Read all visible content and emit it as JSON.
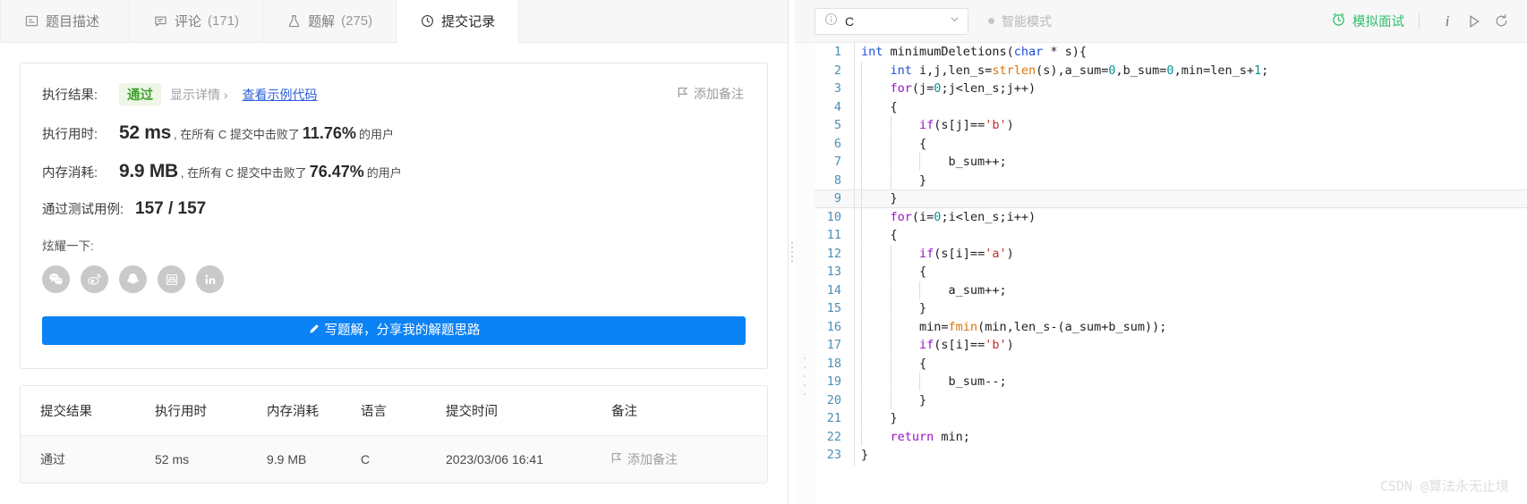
{
  "tabs": [
    {
      "label": "题目描述",
      "count": "",
      "icon": "description-icon",
      "active": false
    },
    {
      "label": "评论",
      "count": "(171)",
      "icon": "comment-icon",
      "active": false
    },
    {
      "label": "题解",
      "count": "(275)",
      "icon": "flask-icon",
      "active": false
    },
    {
      "label": "提交记录",
      "count": "",
      "icon": "clock-icon",
      "active": true
    }
  ],
  "result": {
    "exec_result_label": "执行结果:",
    "status": "通过",
    "show_detail": "显示详情 ›",
    "view_sample_code": "查看示例代码",
    "add_note": "添加备注",
    "runtime_label": "执行用时:",
    "runtime_value": "52 ms",
    "runtime_prefix": ", 在所有 C 提交中击败了",
    "runtime_pct": "11.76%",
    "runtime_suffix": "的用户",
    "memory_label": "内存消耗:",
    "memory_value": "9.9 MB",
    "memory_prefix": ", 在所有 C 提交中击败了",
    "memory_pct": "76.47%",
    "memory_suffix": "的用户",
    "cases_label": "通过测试用例:",
    "cases_value": "157 / 157",
    "share_label": "炫耀一下:",
    "share_buttons": [
      "wechat-icon",
      "weibo-icon",
      "qq-icon",
      "douban-icon",
      "linkedin-icon"
    ],
    "write_solution_button": "写题解，分享我的解题思路"
  },
  "submissions_table": {
    "headers": [
      "提交结果",
      "执行用时",
      "内存消耗",
      "语言",
      "提交时间",
      "备注"
    ],
    "rows": [
      {
        "status": "通过",
        "runtime": "52 ms",
        "memory": "9.9 MB",
        "language": "C",
        "time": "2023/03/06 16:41",
        "note": "添加备注"
      }
    ]
  },
  "editor_header": {
    "language": "C",
    "language_info_icon": "info-icon",
    "chevron_icon": "chevron-down-icon",
    "smart_mode": "智能模式",
    "mock_interview": "模拟面试",
    "info_button": "i",
    "run_icon": "play-icon",
    "reset_icon": "refresh-icon"
  },
  "code": {
    "language": "C",
    "lines": [
      {
        "n": "1",
        "indent": 0,
        "current": false,
        "tokens": [
          {
            "t": "int",
            "c": "typ"
          },
          {
            "t": " ",
            "c": "op"
          },
          {
            "t": "minimumDeletions",
            "c": "fname"
          },
          {
            "t": "(",
            "c": "op"
          },
          {
            "t": "char",
            "c": "typ"
          },
          {
            "t": " * s){",
            "c": "op"
          }
        ]
      },
      {
        "n": "2",
        "indent": 1,
        "current": false,
        "tokens": [
          {
            "t": "int",
            "c": "typ"
          },
          {
            "t": " i,j,len_s=",
            "c": "op"
          },
          {
            "t": "strlen",
            "c": "fn"
          },
          {
            "t": "(s),a_sum=",
            "c": "op"
          },
          {
            "t": "0",
            "c": "num"
          },
          {
            "t": ",b_sum=",
            "c": "op"
          },
          {
            "t": "0",
            "c": "num"
          },
          {
            "t": ",min=len_s+",
            "c": "op"
          },
          {
            "t": "1",
            "c": "num"
          },
          {
            "t": ";",
            "c": "op"
          }
        ]
      },
      {
        "n": "3",
        "indent": 1,
        "current": false,
        "tokens": [
          {
            "t": "for",
            "c": "kw"
          },
          {
            "t": "(j=",
            "c": "op"
          },
          {
            "t": "0",
            "c": "num"
          },
          {
            "t": ";j<len_s;j++)",
            "c": "op"
          }
        ]
      },
      {
        "n": "4",
        "indent": 1,
        "current": false,
        "tokens": [
          {
            "t": "{",
            "c": "op"
          }
        ]
      },
      {
        "n": "5",
        "indent": 2,
        "current": false,
        "tokens": [
          {
            "t": "if",
            "c": "kw"
          },
          {
            "t": "(s[j]==",
            "c": "op"
          },
          {
            "t": "'b'",
            "c": "str"
          },
          {
            "t": ")",
            "c": "op"
          }
        ]
      },
      {
        "n": "6",
        "indent": 2,
        "current": false,
        "tokens": [
          {
            "t": "{",
            "c": "op"
          }
        ]
      },
      {
        "n": "7",
        "indent": 3,
        "current": false,
        "tokens": [
          {
            "t": "b_sum++;",
            "c": "op"
          }
        ]
      },
      {
        "n": "8",
        "indent": 2,
        "current": false,
        "tokens": [
          {
            "t": "}",
            "c": "op"
          }
        ]
      },
      {
        "n": "9",
        "indent": 1,
        "current": true,
        "tokens": [
          {
            "t": "}",
            "c": "op"
          }
        ]
      },
      {
        "n": "10",
        "indent": 1,
        "current": false,
        "tokens": [
          {
            "t": "for",
            "c": "kw"
          },
          {
            "t": "(i=",
            "c": "op"
          },
          {
            "t": "0",
            "c": "num"
          },
          {
            "t": ";i<len_s;i++)",
            "c": "op"
          }
        ]
      },
      {
        "n": "11",
        "indent": 1,
        "current": false,
        "tokens": [
          {
            "t": "{",
            "c": "op"
          }
        ]
      },
      {
        "n": "12",
        "indent": 2,
        "current": false,
        "tokens": [
          {
            "t": "if",
            "c": "kw"
          },
          {
            "t": "(s[i]==",
            "c": "op"
          },
          {
            "t": "'a'",
            "c": "str"
          },
          {
            "t": ")",
            "c": "op"
          }
        ]
      },
      {
        "n": "13",
        "indent": 2,
        "current": false,
        "tokens": [
          {
            "t": "{",
            "c": "op"
          }
        ]
      },
      {
        "n": "14",
        "indent": 3,
        "current": false,
        "tokens": [
          {
            "t": "a_sum++;",
            "c": "op"
          }
        ]
      },
      {
        "n": "15",
        "indent": 2,
        "current": false,
        "tokens": [
          {
            "t": "}",
            "c": "op"
          }
        ]
      },
      {
        "n": "16",
        "indent": 2,
        "current": false,
        "tokens": [
          {
            "t": "min=",
            "c": "op"
          },
          {
            "t": "fmin",
            "c": "fn"
          },
          {
            "t": "(min,len_s-(a_sum+b_sum));",
            "c": "op"
          }
        ]
      },
      {
        "n": "17",
        "indent": 2,
        "current": false,
        "tokens": [
          {
            "t": "if",
            "c": "kw"
          },
          {
            "t": "(s[i]==",
            "c": "op"
          },
          {
            "t": "'b'",
            "c": "str"
          },
          {
            "t": ")",
            "c": "op"
          }
        ]
      },
      {
        "n": "18",
        "indent": 2,
        "current": false,
        "tokens": [
          {
            "t": "{",
            "c": "op"
          }
        ]
      },
      {
        "n": "19",
        "indent": 3,
        "current": false,
        "tokens": [
          {
            "t": "b_sum--;",
            "c": "op"
          }
        ]
      },
      {
        "n": "20",
        "indent": 2,
        "current": false,
        "tokens": [
          {
            "t": "}",
            "c": "op"
          }
        ]
      },
      {
        "n": "21",
        "indent": 1,
        "current": false,
        "tokens": [
          {
            "t": "}",
            "c": "op"
          }
        ]
      },
      {
        "n": "22",
        "indent": 1,
        "current": false,
        "tokens": [
          {
            "t": "return",
            "c": "kw"
          },
          {
            "t": " min;",
            "c": "op"
          }
        ]
      },
      {
        "n": "23",
        "indent": 0,
        "current": false,
        "tokens": [
          {
            "t": "}",
            "c": "op"
          }
        ]
      }
    ]
  },
  "watermark": "CSDN @算法永无止境",
  "colors": {
    "accent_blue": "#0b82f5",
    "pass_green": "#4caf3f",
    "mock_green": "#2fbf6b",
    "link_blue": "#2b5fd9"
  }
}
